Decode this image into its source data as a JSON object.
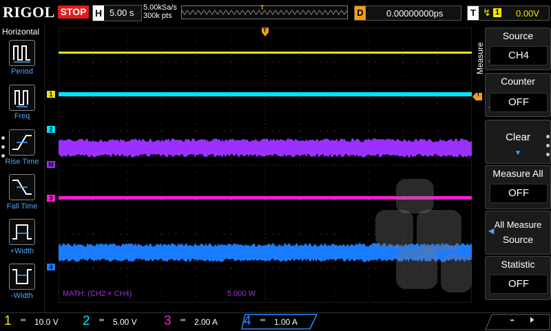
{
  "topbar": {
    "brand": "RIGOL",
    "run_state": "STOP",
    "horizontal_key": "H",
    "timebase": "5.00 s",
    "sample_rate": "5.00kSa/s",
    "memory_depth": "300k pts",
    "trigger_marker": "T",
    "delay_key": "D",
    "delay_value": "0.00000000ps",
    "trigger_key": "T",
    "trigger_edge": "↯",
    "trigger_source": "1",
    "trigger_level": "0.00V"
  },
  "left_panel": {
    "title": "Horizontal",
    "items": [
      {
        "label": "Period",
        "icon": "period-icon"
      },
      {
        "label": "Freq",
        "icon": "freq-icon"
      },
      {
        "label": "Rise Time",
        "icon": "rise-time-icon"
      },
      {
        "label": "Fall Time",
        "icon": "fall-time-icon"
      },
      {
        "label": "+Width",
        "icon": "plus-width-icon"
      },
      {
        "label": "-Width",
        "icon": "minus-width-icon"
      }
    ]
  },
  "plot": {
    "channel_markers": [
      "1",
      "2",
      "M",
      "3",
      "4"
    ],
    "trigger_level_marker": "T",
    "math_label": "MATH: (CH2 × CH4)",
    "math_scale": "5.000 W"
  },
  "right_panel": {
    "tab_label": "Measure",
    "buttons": [
      {
        "title": "Source",
        "value": "CH4"
      },
      {
        "title": "Counter",
        "value": "OFF"
      },
      {
        "title": "Clear",
        "value": ""
      },
      {
        "title": "Measure All",
        "value": "OFF"
      },
      {
        "title": "All Measure",
        "value": "Source"
      },
      {
        "title": "Statistic",
        "value": "OFF"
      }
    ]
  },
  "bottom_bar": {
    "channels": [
      {
        "num": "1",
        "coupling": "═",
        "scale": "10.0 V",
        "color": "#f3e600"
      },
      {
        "num": "2",
        "coupling": "═",
        "scale": "5.00 V",
        "color": "#00e5ff"
      },
      {
        "num": "3",
        "coupling": "═",
        "scale": "2.00 A",
        "color": "#ff1cd6"
      },
      {
        "num": "4",
        "coupling": "═",
        "scale": "1.00 A",
        "color": "#2a8cff"
      }
    ]
  },
  "colors": {
    "ch1": "#f3e600",
    "ch2": "#00e5ff",
    "math": "#9b30ff",
    "ch3": "#ff1cd6",
    "ch4": "#1a7cff",
    "trigger": "#f39a1c",
    "accent": "#4aa8ff"
  }
}
